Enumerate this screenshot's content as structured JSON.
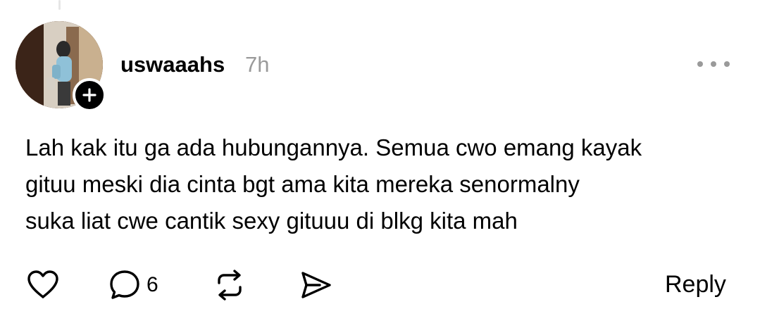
{
  "author": {
    "username": "uswaaahs",
    "timestamp": "7h"
  },
  "post": {
    "lines": [
      "Lah kak itu ga ada hubungannya. Semua cwo emang kayak",
      "gituu meski dia cinta bgt ama kita mereka senormalny",
      "suka liat cwe cantik sexy gituuu di blkg kita mah"
    ]
  },
  "actions": {
    "like_icon": "heart-icon",
    "comment_icon": "comment-bubble-icon",
    "comment_count": "6",
    "repost_icon": "repost-icon",
    "share_icon": "send-icon",
    "reply_label": "Reply"
  },
  "colors": {
    "text": "#000000",
    "muted": "#9a9a9a",
    "background": "#ffffff"
  }
}
